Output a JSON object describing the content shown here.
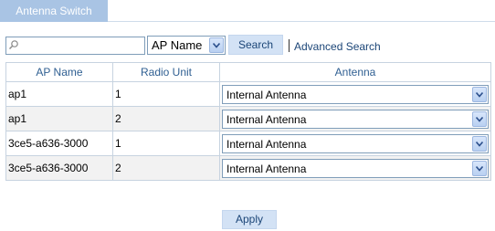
{
  "tabs": [
    {
      "label": "Antenna Switch"
    }
  ],
  "search": {
    "value": "",
    "placeholder": "",
    "field_selected": "AP Name",
    "button_label": "Search",
    "advanced_label": "Advanced Search"
  },
  "table": {
    "headers": [
      "AP Name",
      "Radio Unit",
      "Antenna"
    ],
    "rows": [
      {
        "ap_name": "ap1",
        "radio_unit": "1",
        "antenna": "Internal Antenna"
      },
      {
        "ap_name": "ap1",
        "radio_unit": "2",
        "antenna": "Internal Antenna"
      },
      {
        "ap_name": "3ce5-a636-3000",
        "radio_unit": "1",
        "antenna": "Internal Antenna"
      },
      {
        "ap_name": "3ce5-a636-3000",
        "radio_unit": "2",
        "antenna": "Internal Antenna"
      }
    ]
  },
  "actions": {
    "apply_label": "Apply"
  },
  "colors": {
    "tab_bg": "#a9c4e4",
    "button_bg": "#d3e2f5",
    "link": "#1b4577",
    "header_text": "#2f5f92",
    "alt_row": "#f2f2f2"
  }
}
